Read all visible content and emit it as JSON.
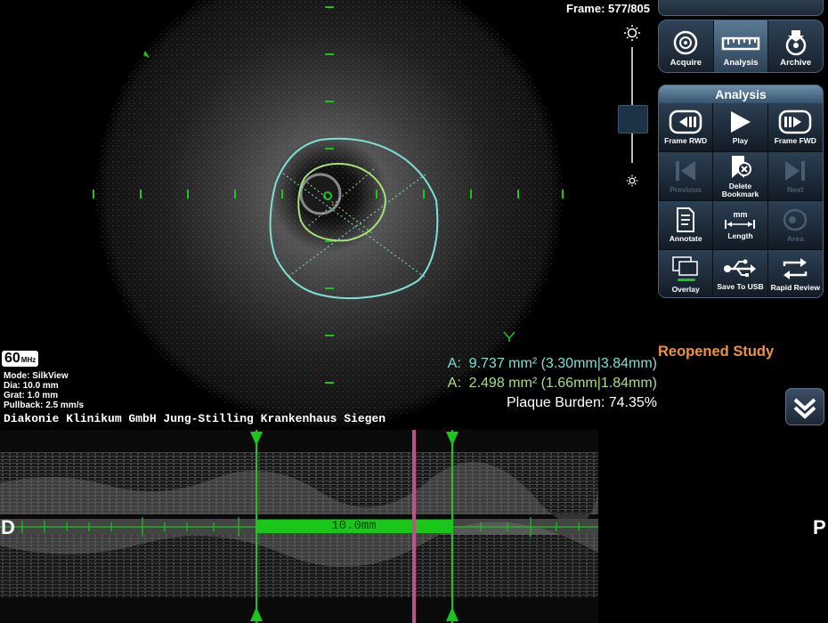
{
  "header": {
    "frame_label": "Frame: 577/805"
  },
  "probe": {
    "frequency": "60",
    "frequency_unit": "MHz",
    "mode": "Mode: SilkView",
    "dia": "Dia: 10.0 mm",
    "grat": "Grat: 1.0 mm",
    "pullback": "Pullback: 2.5 mm/s"
  },
  "hospital": "Diakonie Klinikum GmbH Jung-Stilling Krankenhaus Siegen",
  "measurements": {
    "area1": "A:  9.737 mm² (3.30mm|3.84mm)",
    "area2": "A:  2.498 mm² (1.66mm|1.84mm)",
    "plaque_burden": "Plaque Burden: 74.35%",
    "colors": {
      "area1": "#7de0d6",
      "area2": "#a8e07a",
      "plaque": "#ffffff"
    }
  },
  "status": {
    "study": "Reopened Study",
    "study_color": "#f0923a"
  },
  "longitudinal": {
    "left_end": "D",
    "right_end": "P",
    "segment_length": "10.0mm",
    "segment_color": "#19c619",
    "cursor_color": "#c0508a"
  },
  "modes": [
    {
      "label": "Acquire",
      "icon": "acquire-icon",
      "active": false
    },
    {
      "label": "Analysis",
      "icon": "ruler-icon",
      "active": true
    },
    {
      "label": "Archive",
      "icon": "archive-icon",
      "active": false
    }
  ],
  "panel": {
    "title": "Analysis",
    "buttons": [
      {
        "label": "Frame RWD",
        "icon": "frame-rewind-icon",
        "enabled": true
      },
      {
        "label": "Play",
        "icon": "play-icon",
        "enabled": true
      },
      {
        "label": "Frame FWD",
        "icon": "frame-forward-icon",
        "enabled": true
      },
      {
        "label": "Previous",
        "icon": "previous-bookmark-icon",
        "enabled": false
      },
      {
        "label": "Delete Bookmark",
        "icon": "delete-bookmark-icon",
        "enabled": true
      },
      {
        "label": "Next",
        "icon": "next-bookmark-icon",
        "enabled": false
      },
      {
        "label": "Annotate",
        "icon": "annotate-icon",
        "enabled": true
      },
      {
        "label": "Length",
        "icon": "length-icon",
        "icon_text": "mm",
        "enabled": true
      },
      {
        "label": "Area",
        "icon": "area-icon",
        "enabled": false
      },
      {
        "label": "Overlay",
        "icon": "overlay-icon",
        "enabled": true
      },
      {
        "label": "Save To USB",
        "icon": "usb-icon",
        "enabled": true
      },
      {
        "label": "Rapid Review",
        "icon": "rapid-review-icon",
        "enabled": true
      }
    ]
  },
  "controls": {
    "brightness_icon": "sun-icon",
    "collapse_icon": "chevron-double-down-icon"
  }
}
